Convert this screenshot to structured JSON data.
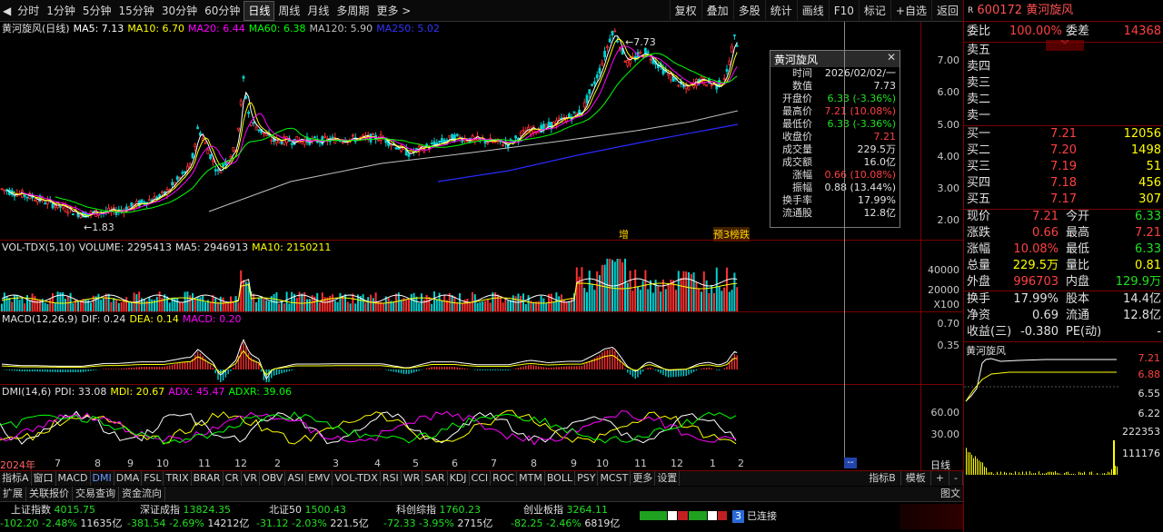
{
  "toolbar": {
    "periods": [
      "分时",
      "1分钟",
      "5分钟",
      "15分钟",
      "30分钟",
      "60分钟",
      "日线",
      "周线",
      "月线",
      "多周期",
      "更多"
    ],
    "active_period": "日线",
    "right": [
      "复权",
      "叠加",
      "多股",
      "统计",
      "画线",
      "F10",
      "标记",
      "+自选",
      "返回"
    ]
  },
  "main_legend": {
    "name": "黄河旋风(日线)",
    "items": [
      {
        "label": "MA5: 7.13",
        "color": "#ffffff"
      },
      {
        "label": "MA10: 6.70",
        "color": "#ffff00"
      },
      {
        "label": "MA20: 6.44",
        "color": "#ff00ff"
      },
      {
        "label": "MA60: 6.38",
        "color": "#00ff00"
      },
      {
        "label": "MA120: 5.90",
        "color": "#c0c0c0"
      },
      {
        "label": "MA250: 5.02",
        "color": "#3333ff"
      }
    ]
  },
  "price_axis": [
    "7.00",
    "6.00",
    "5.00",
    "4.00",
    "3.00",
    "2.00"
  ],
  "price_annotations": {
    "high": "7.73",
    "low": "1.83"
  },
  "event_labels": [
    "增",
    "预3榜跌"
  ],
  "tooltip": {
    "title": "黄河旋风",
    "rows": [
      {
        "k": "时间",
        "v": "2026/02/02/一",
        "c": "#e0e0e0"
      },
      {
        "k": "数值",
        "v": "7.73",
        "c": "#e0e0e0"
      },
      {
        "k": "开盘价",
        "v": "6.33 (-3.36%)",
        "c": "#20e020"
      },
      {
        "k": "最高价",
        "v": "7.21 (10.08%)",
        "c": "#ff4040"
      },
      {
        "k": "最低价",
        "v": "6.33 (-3.36%)",
        "c": "#20e020"
      },
      {
        "k": "收盘价",
        "v": "7.21",
        "c": "#ff4040"
      },
      {
        "k": "成交量",
        "v": "229.5万",
        "c": "#e0e0e0"
      },
      {
        "k": "成交额",
        "v": "16.0亿",
        "c": "#e0e0e0"
      },
      {
        "k": "涨幅",
        "v": "0.66 (10.08%)",
        "c": "#ff4040"
      },
      {
        "k": "振幅",
        "v": "0.88 (13.44%)",
        "c": "#e0e0e0"
      },
      {
        "k": "换手率",
        "v": "17.99%",
        "c": "#e0e0e0"
      },
      {
        "k": "流通股",
        "v": "12.8亿",
        "c": "#e0e0e0"
      }
    ]
  },
  "vol_legend": {
    "name": "VOL-TDX(5,10)",
    "items": [
      {
        "label": "VOLUME: 2295413",
        "color": "#e0e0e0"
      },
      {
        "label": "MA5: 2946913",
        "color": "#e0e0e0"
      },
      {
        "label": "MA10: 2150211",
        "color": "#ffff00"
      }
    ]
  },
  "vol_axis": [
    "40000",
    "20000",
    "X100"
  ],
  "macd_legend": {
    "name": "MACD(12,26,9)",
    "items": [
      {
        "label": "DIF: 0.24",
        "color": "#e0e0e0"
      },
      {
        "label": "DEA: 0.14",
        "color": "#ffff00"
      },
      {
        "label": "MACD: 0.20",
        "color": "#ff00ff"
      }
    ]
  },
  "macd_axis": [
    "0.70",
    "0.35"
  ],
  "dmi_legend": {
    "name": "DMI(14,6)",
    "items": [
      {
        "label": "PDI: 33.08",
        "color": "#e0e0e0"
      },
      {
        "label": "MDI: 20.67",
        "color": "#ffff00"
      },
      {
        "label": "ADX: 45.47",
        "color": "#ff00ff"
      },
      {
        "label": "ADXR: 39.06",
        "color": "#00ff00"
      }
    ]
  },
  "dmi_axis": [
    "60.00",
    "30.00"
  ],
  "x_axis": [
    {
      "t": "2024年",
      "p": 0
    },
    {
      "t": "7",
      "p": 60
    },
    {
      "t": "8",
      "p": 104
    },
    {
      "t": "9",
      "p": 140
    },
    {
      "t": "10",
      "p": 172
    },
    {
      "t": "11",
      "p": 218
    },
    {
      "t": "12",
      "p": 258
    },
    {
      "t": "2",
      "p": 302
    },
    {
      "t": "3",
      "p": 366
    },
    {
      "t": "4",
      "p": 412
    },
    {
      "t": "5",
      "p": 454
    },
    {
      "t": "6",
      "p": 497
    },
    {
      "t": "7",
      "p": 540
    },
    {
      "t": "8",
      "p": 584
    },
    {
      "t": "9",
      "p": 628
    },
    {
      "t": "10",
      "p": 656
    },
    {
      "t": "11",
      "p": 698
    },
    {
      "t": "12",
      "p": 738
    },
    {
      "t": "1",
      "p": 781
    },
    {
      "t": "2",
      "p": 812
    }
  ],
  "x_axis_right": "日线",
  "indicator_tabs": [
    "指标A",
    "窗口",
    "MACD",
    "DMI",
    "DMA",
    "FSL",
    "TRIX",
    "BRAR",
    "CR",
    "VR",
    "OBV",
    "ASI",
    "EMV",
    "VOL-TDX",
    "RSI",
    "WR",
    "SAR",
    "KDJ",
    "CCI",
    "ROC",
    "MTM",
    "BOLL",
    "PSY",
    "MCST",
    "更多",
    "设置"
  ],
  "active_indicator": "DMI",
  "indicator_right": [
    "指标B",
    "模板",
    "+",
    "-"
  ],
  "sub_tabs": [
    "扩展",
    "关联报价",
    "交易查询",
    "资金流向"
  ],
  "status": {
    "indices": [
      {
        "name": "上证指数",
        "value": "4015.75",
        "chg": "-102.20",
        "pct": "-2.48%",
        "amt": "11635亿"
      },
      {
        "name": "深证成指",
        "value": "13824.35",
        "chg": "-381.54",
        "pct": "-2.69%",
        "amt": "14212亿"
      },
      {
        "name": "北证50",
        "value": "1500.43",
        "chg": "-31.12",
        "pct": "-2.03%",
        "amt": "221.5亿"
      },
      {
        "name": "科创综指",
        "value": "1760.23",
        "chg": "-72.33",
        "pct": "-3.95%",
        "amt": "2715亿"
      },
      {
        "name": "创业板指",
        "value": "3264.11",
        "chg": "-82.25",
        "pct": "-2.46%",
        "amt": "6819亿"
      }
    ],
    "connection_count": "3",
    "connection_text": "已连接",
    "tuwen": "图文"
  },
  "quote": {
    "r_mark": "R",
    "code": "600172",
    "name": "黄河旋风",
    "weibi_label": "委比",
    "weibi": "100.00%",
    "weicha_label": "委差",
    "weicha": "14368",
    "sells": [
      "卖五",
      "卖四",
      "卖三",
      "卖二",
      "卖一"
    ],
    "buys": [
      {
        "k": "买一",
        "p": "7.21",
        "v": "12056"
      },
      {
        "k": "买二",
        "p": "7.20",
        "v": "1498"
      },
      {
        "k": "买三",
        "p": "7.19",
        "v": "51"
      },
      {
        "k": "买四",
        "p": "7.18",
        "v": "456"
      },
      {
        "k": "买五",
        "p": "7.17",
        "v": "307"
      }
    ],
    "stats": [
      {
        "k1": "现价",
        "v1": "7.21",
        "c1": "#ff4040",
        "k2": "今开",
        "v2": "6.33",
        "c2": "#20e020"
      },
      {
        "k1": "涨跌",
        "v1": "0.66",
        "c1": "#ff4040",
        "k2": "最高",
        "v2": "7.21",
        "c2": "#ff4040"
      },
      {
        "k1": "涨幅",
        "v1": "10.08%",
        "c1": "#ff4040",
        "k2": "最低",
        "v2": "6.33",
        "c2": "#20e020"
      },
      {
        "k1": "总量",
        "v1": "229.5万",
        "c1": "#ffff00",
        "k2": "量比",
        "v2": "0.81",
        "c2": "#ffff00"
      },
      {
        "k1": "外盘",
        "v1": "996703",
        "c1": "#ff4040",
        "k2": "内盘",
        "v2": "129.9万",
        "c2": "#20e020"
      }
    ],
    "stats2": [
      {
        "k1": "换手",
        "v1": "17.99%",
        "k2": "股本",
        "v2": "14.4亿"
      },
      {
        "k1": "净资",
        "v1": "0.69",
        "k2": "流通",
        "v2": "12.8亿"
      },
      {
        "k1": "收益(三)",
        "v1": "-0.380",
        "k2": "PE(动)",
        "v2": "-"
      }
    ],
    "mini_title": "黄河旋风",
    "mini_axis": [
      "7.21",
      "6.88",
      "6.55",
      "6.22",
      "222353",
      "111176"
    ]
  }
}
